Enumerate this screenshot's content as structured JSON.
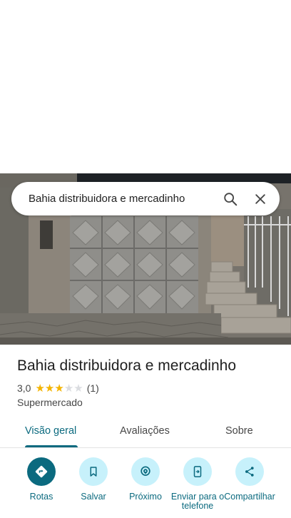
{
  "search": {
    "query": "Bahia distribuidora e mercadinho"
  },
  "place": {
    "name": "Bahia distribuidora e mercadinho",
    "rating": "3,0",
    "stars": 3,
    "stars_max": 5,
    "review_count": "(1)",
    "category": "Supermercado"
  },
  "tabs": [
    {
      "label": "Visão geral",
      "active": true
    },
    {
      "label": "Avaliações",
      "active": false
    },
    {
      "label": "Sobre",
      "active": false
    }
  ],
  "actions": [
    {
      "label": "Rotas",
      "icon": "directions-icon"
    },
    {
      "label": "Salvar",
      "icon": "bookmark-icon"
    },
    {
      "label": "Próximo",
      "icon": "nearby-icon"
    },
    {
      "label": "Enviar para o telefone",
      "icon": "send-to-phone-icon"
    },
    {
      "label": "Compartilhar",
      "icon": "share-icon"
    }
  ],
  "colors": {
    "accent": "#0b6a7f",
    "action_bg": "#c7f1fb",
    "star": "#f4b400"
  }
}
